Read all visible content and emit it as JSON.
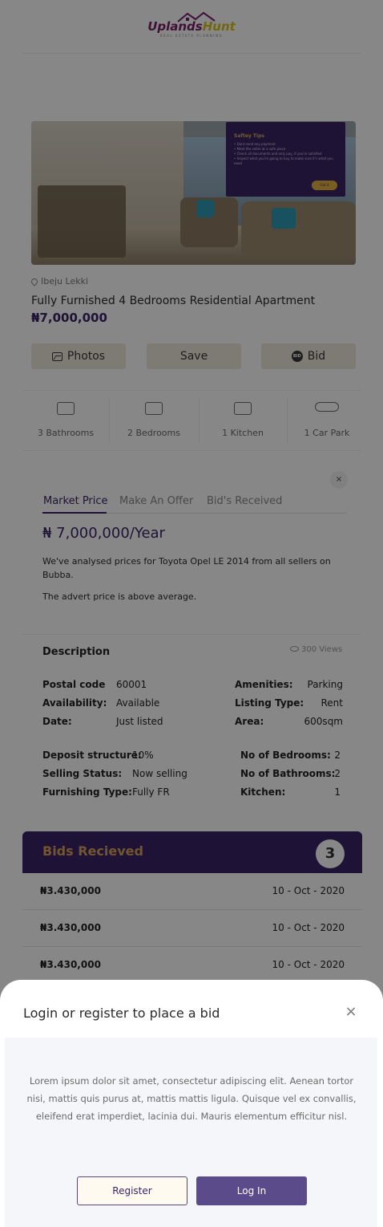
{
  "brand": {
    "name_part1": "Uplands",
    "name_part2": "Hunt",
    "tagline": "REAL ESTATE PLANNING",
    "colors": {
      "primary": "#7a1f6a",
      "accent": "#d9c21a"
    }
  },
  "listing": {
    "location": "Ibeju Lekki",
    "title": "Fully Furnished 4 Bedrooms Residential Apartment",
    "price": "₦7,000,000",
    "safety_tips": {
      "title": "Saftey Tips",
      "lines": [
        "• Dont send any payment",
        "• Meet the seller at a safe place",
        "• Check all documents and only pay, if you're satisfied",
        "• Inspect what you're going to buy to make sure it's what you need"
      ],
      "button": "Got it"
    }
  },
  "actions": {
    "photos": "Photos",
    "save": "Save",
    "bid": "Bid",
    "bid_icon": "BID"
  },
  "features": [
    {
      "icon": "bathtub-icon",
      "label": "3 Bathrooms"
    },
    {
      "icon": "bed-icon",
      "label": "2 Bedrooms"
    },
    {
      "icon": "kitchen-icon",
      "label": "1 Kitchen"
    },
    {
      "icon": "car-icon",
      "label": "1 Car Park"
    }
  ],
  "market": {
    "close": "×",
    "tabs": [
      "Market Price",
      "Make An Offer",
      "Bid's Received"
    ],
    "price": "₦ 7,000,000/Year",
    "text1": "We've analysed prices for Toyota Opel LE 2014 from all sellers on Bubba.",
    "text2": "The advert price is above average."
  },
  "description": {
    "title": "Description",
    "views": "300 Views",
    "left": [
      {
        "k": "Postal code",
        "v": "60001"
      },
      {
        "k": "Availability:",
        "v": "Available"
      },
      {
        "k": "Date:",
        "v": "Just listed"
      }
    ],
    "right": [
      {
        "k": "Amenities:",
        "v": "Parking"
      },
      {
        "k": "Listing Type:",
        "v": "Rent"
      },
      {
        "k": "Area:",
        "v": "600sqm"
      }
    ],
    "left2": [
      {
        "k": "Deposit structure:",
        "v": "10%"
      },
      {
        "k": "Selling Status:",
        "v": "Now selling"
      },
      {
        "k": "Furnishing Type:",
        "v": "Fully FR"
      }
    ],
    "right2": [
      {
        "k": "No of Bedrooms:",
        "v": "2"
      },
      {
        "k": "No of Bathrooms:",
        "v": "2"
      },
      {
        "k": "Kitchen:",
        "v": "1"
      }
    ]
  },
  "bids": {
    "title": "Bids Recieved",
    "count": "3",
    "rows": [
      {
        "amount": "₦3.430,000",
        "date": "10 - Oct - 2020"
      },
      {
        "amount": "₦3.430,000",
        "date": "10 - Oct - 2020"
      },
      {
        "amount": "₦3.430,000",
        "date": "10 - Oct - 2020"
      }
    ]
  },
  "sheet": {
    "title": "Login or register to place a bid",
    "close": "×",
    "text": "Lorem ipsum dolor sit amet, consectetur adipiscing elit. Aenean tortor nisi, mattis quis purus at, mattis mattis ligula. Quisque vel ex convallis, eleifend erat imperdiet, lacinia dui. Mauris elementum efficitur nisl.",
    "register": "Register",
    "login": "Log In"
  }
}
